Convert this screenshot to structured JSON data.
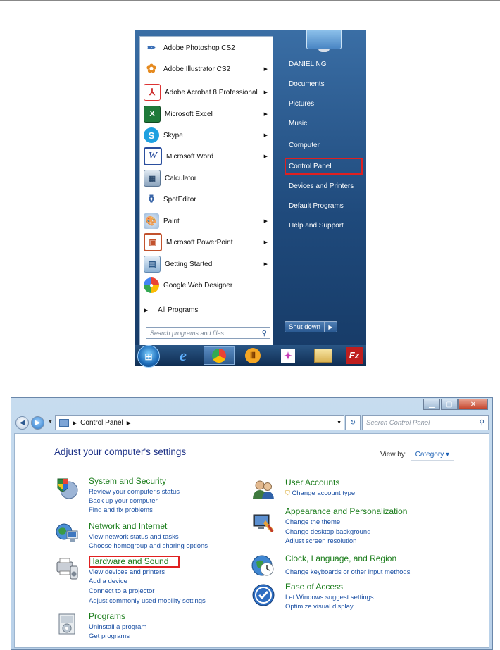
{
  "start_menu": {
    "programs": [
      {
        "label": "Adobe Photoshop CS2",
        "icon": "feather-icon",
        "submenu": false,
        "color": "#3b6fb6"
      },
      {
        "label": "Adobe Illustrator CS2",
        "icon": "flower-icon",
        "submenu": true,
        "color": "#e58a1f"
      },
      {
        "label": "Adobe Acrobat 8 Professional",
        "icon": "acrobat-icon",
        "submenu": true,
        "color": "#cc2b2b"
      },
      {
        "label": "Microsoft Excel",
        "icon": "excel-icon",
        "submenu": true,
        "color": "#1f7a3a"
      },
      {
        "label": "Skype",
        "icon": "skype-icon",
        "submenu": true,
        "color": "#1ea0e0"
      },
      {
        "label": "Microsoft Word",
        "icon": "word-icon",
        "submenu": true,
        "color": "#2b4f9e"
      },
      {
        "label": "Calculator",
        "icon": "calculator-icon",
        "submenu": false,
        "color": "#6d8aa8"
      },
      {
        "label": "SpotEditor",
        "icon": "spoteditor-icon",
        "submenu": false,
        "color": "#3a66a8"
      },
      {
        "label": "Paint",
        "icon": "palette-icon",
        "submenu": true,
        "color": "#7aa4d0"
      },
      {
        "label": "Microsoft PowerPoint",
        "icon": "powerpoint-icon",
        "submenu": true,
        "color": "#c2522d"
      },
      {
        "label": "Getting Started",
        "icon": "getting-started-icon",
        "submenu": true,
        "color": "#6fa0c8"
      },
      {
        "label": "Google Web Designer",
        "icon": "google-web-designer-icon",
        "submenu": false,
        "color": "#f0a51a"
      }
    ],
    "all_programs": "All Programs",
    "search_placeholder": "Search programs and files",
    "right_links": [
      "DANIEL NG",
      "Documents",
      "Pictures",
      "Music",
      "Computer",
      "Control Panel",
      "Devices and Printers",
      "Default Programs",
      "Help and Support"
    ],
    "shutdown_label": "Shut down",
    "taskbar_icons": [
      "windows-orb-icon",
      "internet-explorer-icon",
      "chrome-icon",
      "media-icon",
      "paint-app-icon",
      "file-explorer-icon",
      "filezilla-icon"
    ]
  },
  "control_panel": {
    "breadcrumb": "Control Panel",
    "search_placeholder": "Search Control Panel",
    "title": "Adjust your computer's settings",
    "view_by_label": "View by:",
    "view_by_value": "Category",
    "categories_left": [
      {
        "title": "System and Security",
        "icon": "system-security-icon",
        "links": [
          "Review your computer's status",
          "Back up your computer",
          "Find and fix problems"
        ]
      },
      {
        "title": "Network and Internet",
        "icon": "network-internet-icon",
        "links": [
          "View network status and tasks",
          "Choose homegroup and sharing options"
        ]
      },
      {
        "title": "Hardware and Sound",
        "icon": "hardware-sound-icon",
        "links": [
          "View devices and printers",
          "Add a device",
          "Connect to a projector",
          "Adjust commonly used mobility settings"
        ]
      },
      {
        "title": "Programs",
        "icon": "programs-icon",
        "links": [
          "Uninstall a program",
          "Get programs"
        ]
      }
    ],
    "categories_right": [
      {
        "title": "User Accounts",
        "icon": "user-accounts-icon",
        "links": [
          "Change account type"
        ]
      },
      {
        "title": "Appearance and Personalization",
        "icon": "appearance-icon",
        "links": [
          "Change the theme",
          "Change desktop background",
          "Adjust screen resolution"
        ]
      },
      {
        "title": "Clock, Language, and Region",
        "icon": "clock-globe-icon",
        "links": [
          "Change keyboards or other input methods"
        ]
      },
      {
        "title": "Ease of Access",
        "icon": "ease-of-access-icon",
        "links": [
          "Let Windows suggest settings",
          "Optimize visual display"
        ]
      }
    ]
  }
}
